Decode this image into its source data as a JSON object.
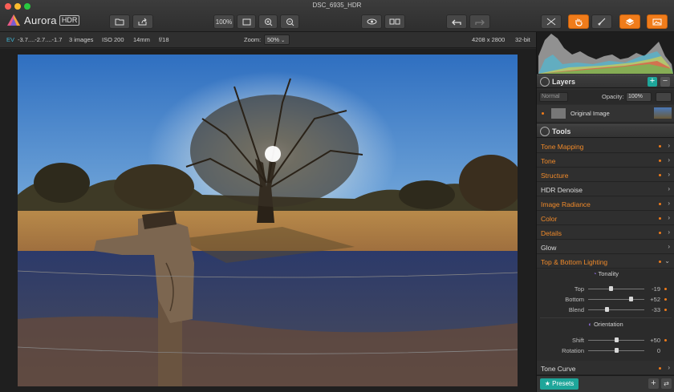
{
  "window": {
    "title": "DSC_6935_HDR"
  },
  "app": {
    "name": "Aurora",
    "badge": "HDR"
  },
  "toolbar": {
    "zoom_fit_label": "100%",
    "buttons": [
      "open-icon",
      "share-icon",
      "fit-screen-icon",
      "zoom-in-icon",
      "zoom-out-icon",
      "preview-eye-icon",
      "compare-icon",
      "undo-icon",
      "redo-icon",
      "crop-icon",
      "hand-icon",
      "brush-icon",
      "layers-icon",
      "image-icon"
    ]
  },
  "infobar": {
    "ev_label": "EV",
    "ev_values": "-3.7....-2.7....-1.7",
    "images": "3 images",
    "iso": "ISO 200",
    "focal": "14mm",
    "aperture": "f/18",
    "zoom_label": "Zoom:",
    "zoom_value": "50%",
    "dimensions": "4208 x 2800",
    "bitdepth": "32-bit"
  },
  "layers": {
    "title": "Layers",
    "blend_mode": "Normal",
    "opacity_label": "Opacity:",
    "opacity_value": "100%",
    "items": [
      {
        "name": "Original Image"
      }
    ]
  },
  "tools": {
    "title": "Tools",
    "items": [
      {
        "label": "Tone Mapping",
        "active": true
      },
      {
        "label": "Tone",
        "active": true
      },
      {
        "label": "Structure",
        "active": true
      },
      {
        "label": "HDR Denoise",
        "active": false
      },
      {
        "label": "Image Radiance",
        "active": true
      },
      {
        "label": "Color",
        "active": true
      },
      {
        "label": "Details",
        "active": true
      },
      {
        "label": "Glow",
        "active": false
      },
      {
        "label": "Top & Bottom Lighting",
        "active": true
      }
    ],
    "expanded": {
      "tonality_label": "Tonality",
      "sliders_tonality": [
        {
          "label": "Top",
          "value": "-19",
          "fraction": 0.4
        },
        {
          "label": "Bottom",
          "value": "+52",
          "fraction": 0.76
        },
        {
          "label": "Blend",
          "value": "-33",
          "fraction": 0.33
        }
      ],
      "orientation_label": "Orientation",
      "sliders_orientation": [
        {
          "label": "Shift",
          "value": "+50",
          "fraction": 0.5
        },
        {
          "label": "Rotation",
          "value": "0",
          "fraction": 0.5
        }
      ]
    },
    "last_item": "Tone Curve"
  },
  "presets": {
    "label": "★ Presets"
  },
  "colors": {
    "accent": "#f07c1b",
    "teal": "#1ea69a",
    "tool_label": "#f08a2a"
  }
}
